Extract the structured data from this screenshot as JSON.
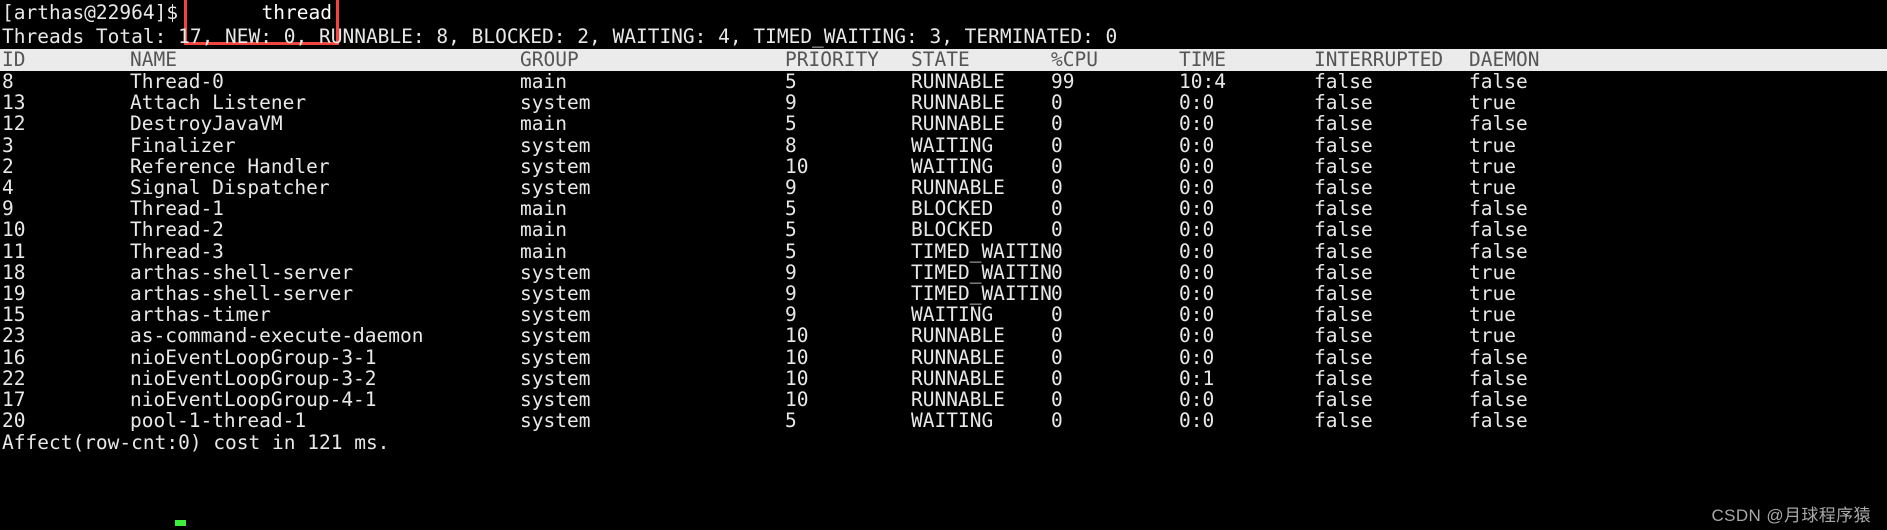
{
  "prompt": {
    "text": "[arthas@22964]$",
    "command": "thread"
  },
  "summary": "Threads Total: 17, NEW: 0, RUNNABLE: 8, BLOCKED: 2, WAITING: 4, TIMED_WAITING: 3, TERMINATED: 0",
  "columns": [
    "ID",
    "NAME",
    "GROUP",
    "PRIORITY",
    "STATE",
    "%CPU",
    "TIME",
    "INTERRUPTED",
    "DAEMON"
  ],
  "rows": [
    {
      "id": "8",
      "name": "Thread-0",
      "group": "main",
      "priority": "5",
      "state": "RUNNABLE",
      "cpu": "99",
      "time": "10:4",
      "interrupted": "false",
      "daemon": "false"
    },
    {
      "id": "13",
      "name": "Attach Listener",
      "group": "system",
      "priority": "9",
      "state": "RUNNABLE",
      "cpu": "0",
      "time": "0:0",
      "interrupted": "false",
      "daemon": "true"
    },
    {
      "id": "12",
      "name": "DestroyJavaVM",
      "group": "main",
      "priority": "5",
      "state": "RUNNABLE",
      "cpu": "0",
      "time": "0:0",
      "interrupted": "false",
      "daemon": "false"
    },
    {
      "id": "3",
      "name": "Finalizer",
      "group": "system",
      "priority": "8",
      "state": "WAITING",
      "cpu": "0",
      "time": "0:0",
      "interrupted": "false",
      "daemon": "true"
    },
    {
      "id": "2",
      "name": "Reference Handler",
      "group": "system",
      "priority": "10",
      "state": "WAITING",
      "cpu": "0",
      "time": "0:0",
      "interrupted": "false",
      "daemon": "true"
    },
    {
      "id": "4",
      "name": "Signal Dispatcher",
      "group": "system",
      "priority": "9",
      "state": "RUNNABLE",
      "cpu": "0",
      "time": "0:0",
      "interrupted": "false",
      "daemon": "true"
    },
    {
      "id": "9",
      "name": "Thread-1",
      "group": "main",
      "priority": "5",
      "state": "BLOCKED",
      "cpu": "0",
      "time": "0:0",
      "interrupted": "false",
      "daemon": "false"
    },
    {
      "id": "10",
      "name": "Thread-2",
      "group": "main",
      "priority": "5",
      "state": "BLOCKED",
      "cpu": "0",
      "time": "0:0",
      "interrupted": "false",
      "daemon": "false"
    },
    {
      "id": "11",
      "name": "Thread-3",
      "group": "main",
      "priority": "5",
      "state": "TIMED_WAITIN",
      "cpu": "0",
      "time": "0:0",
      "interrupted": "false",
      "daemon": "false"
    },
    {
      "id": "18",
      "name": "arthas-shell-server",
      "group": "system",
      "priority": "9",
      "state": "TIMED_WAITIN",
      "cpu": "0",
      "time": "0:0",
      "interrupted": "false",
      "daemon": "true"
    },
    {
      "id": "19",
      "name": "arthas-shell-server",
      "group": "system",
      "priority": "9",
      "state": "TIMED_WAITIN",
      "cpu": "0",
      "time": "0:0",
      "interrupted": "false",
      "daemon": "true"
    },
    {
      "id": "15",
      "name": "arthas-timer",
      "group": "system",
      "priority": "9",
      "state": "WAITING",
      "cpu": "0",
      "time": "0:0",
      "interrupted": "false",
      "daemon": "true"
    },
    {
      "id": "23",
      "name": "as-command-execute-daemon",
      "group": "system",
      "priority": "10",
      "state": "RUNNABLE",
      "cpu": "0",
      "time": "0:0",
      "interrupted": "false",
      "daemon": "true"
    },
    {
      "id": "16",
      "name": "nioEventLoopGroup-3-1",
      "group": "system",
      "priority": "10",
      "state": "RUNNABLE",
      "cpu": "0",
      "time": "0:0",
      "interrupted": "false",
      "daemon": "false"
    },
    {
      "id": "22",
      "name": "nioEventLoopGroup-3-2",
      "group": "system",
      "priority": "10",
      "state": "RUNNABLE",
      "cpu": "0",
      "time": "0:1",
      "interrupted": "false",
      "daemon": "false"
    },
    {
      "id": "17",
      "name": "nioEventLoopGroup-4-1",
      "group": "system",
      "priority": "10",
      "state": "RUNNABLE",
      "cpu": "0",
      "time": "0:0",
      "interrupted": "false",
      "daemon": "false"
    },
    {
      "id": "20",
      "name": "pool-1-thread-1",
      "group": "system",
      "priority": "5",
      "state": "WAITING",
      "cpu": "0",
      "time": "0:0",
      "interrupted": "false",
      "daemon": "false"
    }
  ],
  "footer": "Affect(row-cnt:0) cost in 121 ms.",
  "watermark": "CSDN @月球程序猿",
  "colors": {
    "background": "#000000",
    "foreground": "#e8e8e8",
    "header_bg": "#ebebeb",
    "header_fg": "#555555",
    "runnable": "#0ea30e",
    "waiting": "#d9c000",
    "blocked": "#e01b1b",
    "timed_waiting": "#d817d8",
    "daemon_false": "#d817d8",
    "command_box_border": "#f2453d",
    "cursor": "#3cf03c"
  }
}
